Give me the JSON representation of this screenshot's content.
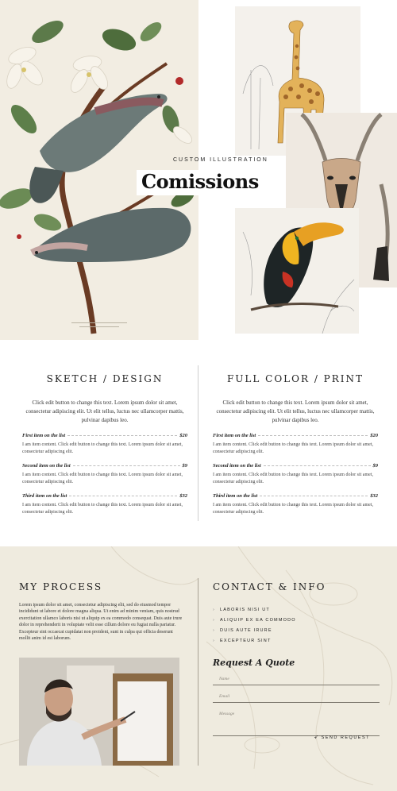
{
  "hero": {
    "eyebrow": "CUSTOM ILLUSTRATION",
    "title": "Comissions"
  },
  "pricing": {
    "columns": [
      {
        "heading": "SKETCH / DESIGN",
        "description": "Click edit button to change this text. Lorem ipsum dolor sit amet, consectetur adipiscing elit. Ut elit tellus, luctus nec ullamcorper mattis, pulvinar dapibus leo.",
        "items": [
          {
            "name": "First item on the list",
            "price": "$20",
            "desc": "I am item content. Click edit button to change this text. Lorem ipsum dolor sit amet, consectetur adipiscing elit."
          },
          {
            "name": "Second item on the list",
            "price": "$9",
            "desc": "I am item content. Click edit button to change this text. Lorem ipsum dolor sit amet, consectetur adipiscing elit."
          },
          {
            "name": "Third item on the list",
            "price": "$32",
            "desc": "I am item content. Click edit button to change this text. Lorem ipsum dolor sit amet, consectetur adipiscing elit."
          }
        ]
      },
      {
        "heading": "FULL COLOR / PRINT",
        "description": "Click edit button to change this text. Lorem ipsum dolor sit amet, consectetur adipiscing elit. Ut elit tellus, luctus nec ullamcorper mattis, pulvinar dapibus leo.",
        "items": [
          {
            "name": "First item on the list",
            "price": "$20",
            "desc": "I am item content. Click edit button to change this text. Lorem ipsum dolor sit amet, consectetur adipiscing elit."
          },
          {
            "name": "Second item on the list",
            "price": "$9",
            "desc": "I am item content. Click edit button to change this text. Lorem ipsum dolor sit amet, consectetur adipiscing elit."
          },
          {
            "name": "Third item on the list",
            "price": "$32",
            "desc": "I am item content. Click edit button to change this text. Lorem ipsum dolor sit amet, consectetur adipiscing elit."
          }
        ]
      }
    ]
  },
  "process": {
    "heading": "MY PROCESS",
    "body": "Lorem ipsum dolor sit amet, consectetur adipiscing elit, sed do eiusmod tempor incididunt ut labore et dolore magna aliqua. Ut enim ad minim veniam, quis nostrud exercitation ullamco laboris nisi ut aliquip ex ea commodo consequat. Duis aute irure dolor in reprehenderit in voluptate velit esse cillum dolore eu fugiat nulla pariatur. Excepteur sint occaecat cupidatat non proident, sunt in culpa qui officia deserunt mollit anim id est laborum."
  },
  "contact": {
    "heading": "CONTACT & INFO",
    "items": [
      "LABORIS NISI UT",
      "ALIQUIP EX EA COMMODO",
      "DUIS AUTE IRURE",
      "EXCEPTEUR SINT"
    ],
    "quote_title": "Request A Quote",
    "name_placeholder": "Name",
    "email_placeholder": "Email",
    "message_placeholder": "Message",
    "send_label": "SEND REQUEST"
  },
  "colors": {
    "bottom_bg": "#efebdf",
    "accent_text": "#222222"
  }
}
